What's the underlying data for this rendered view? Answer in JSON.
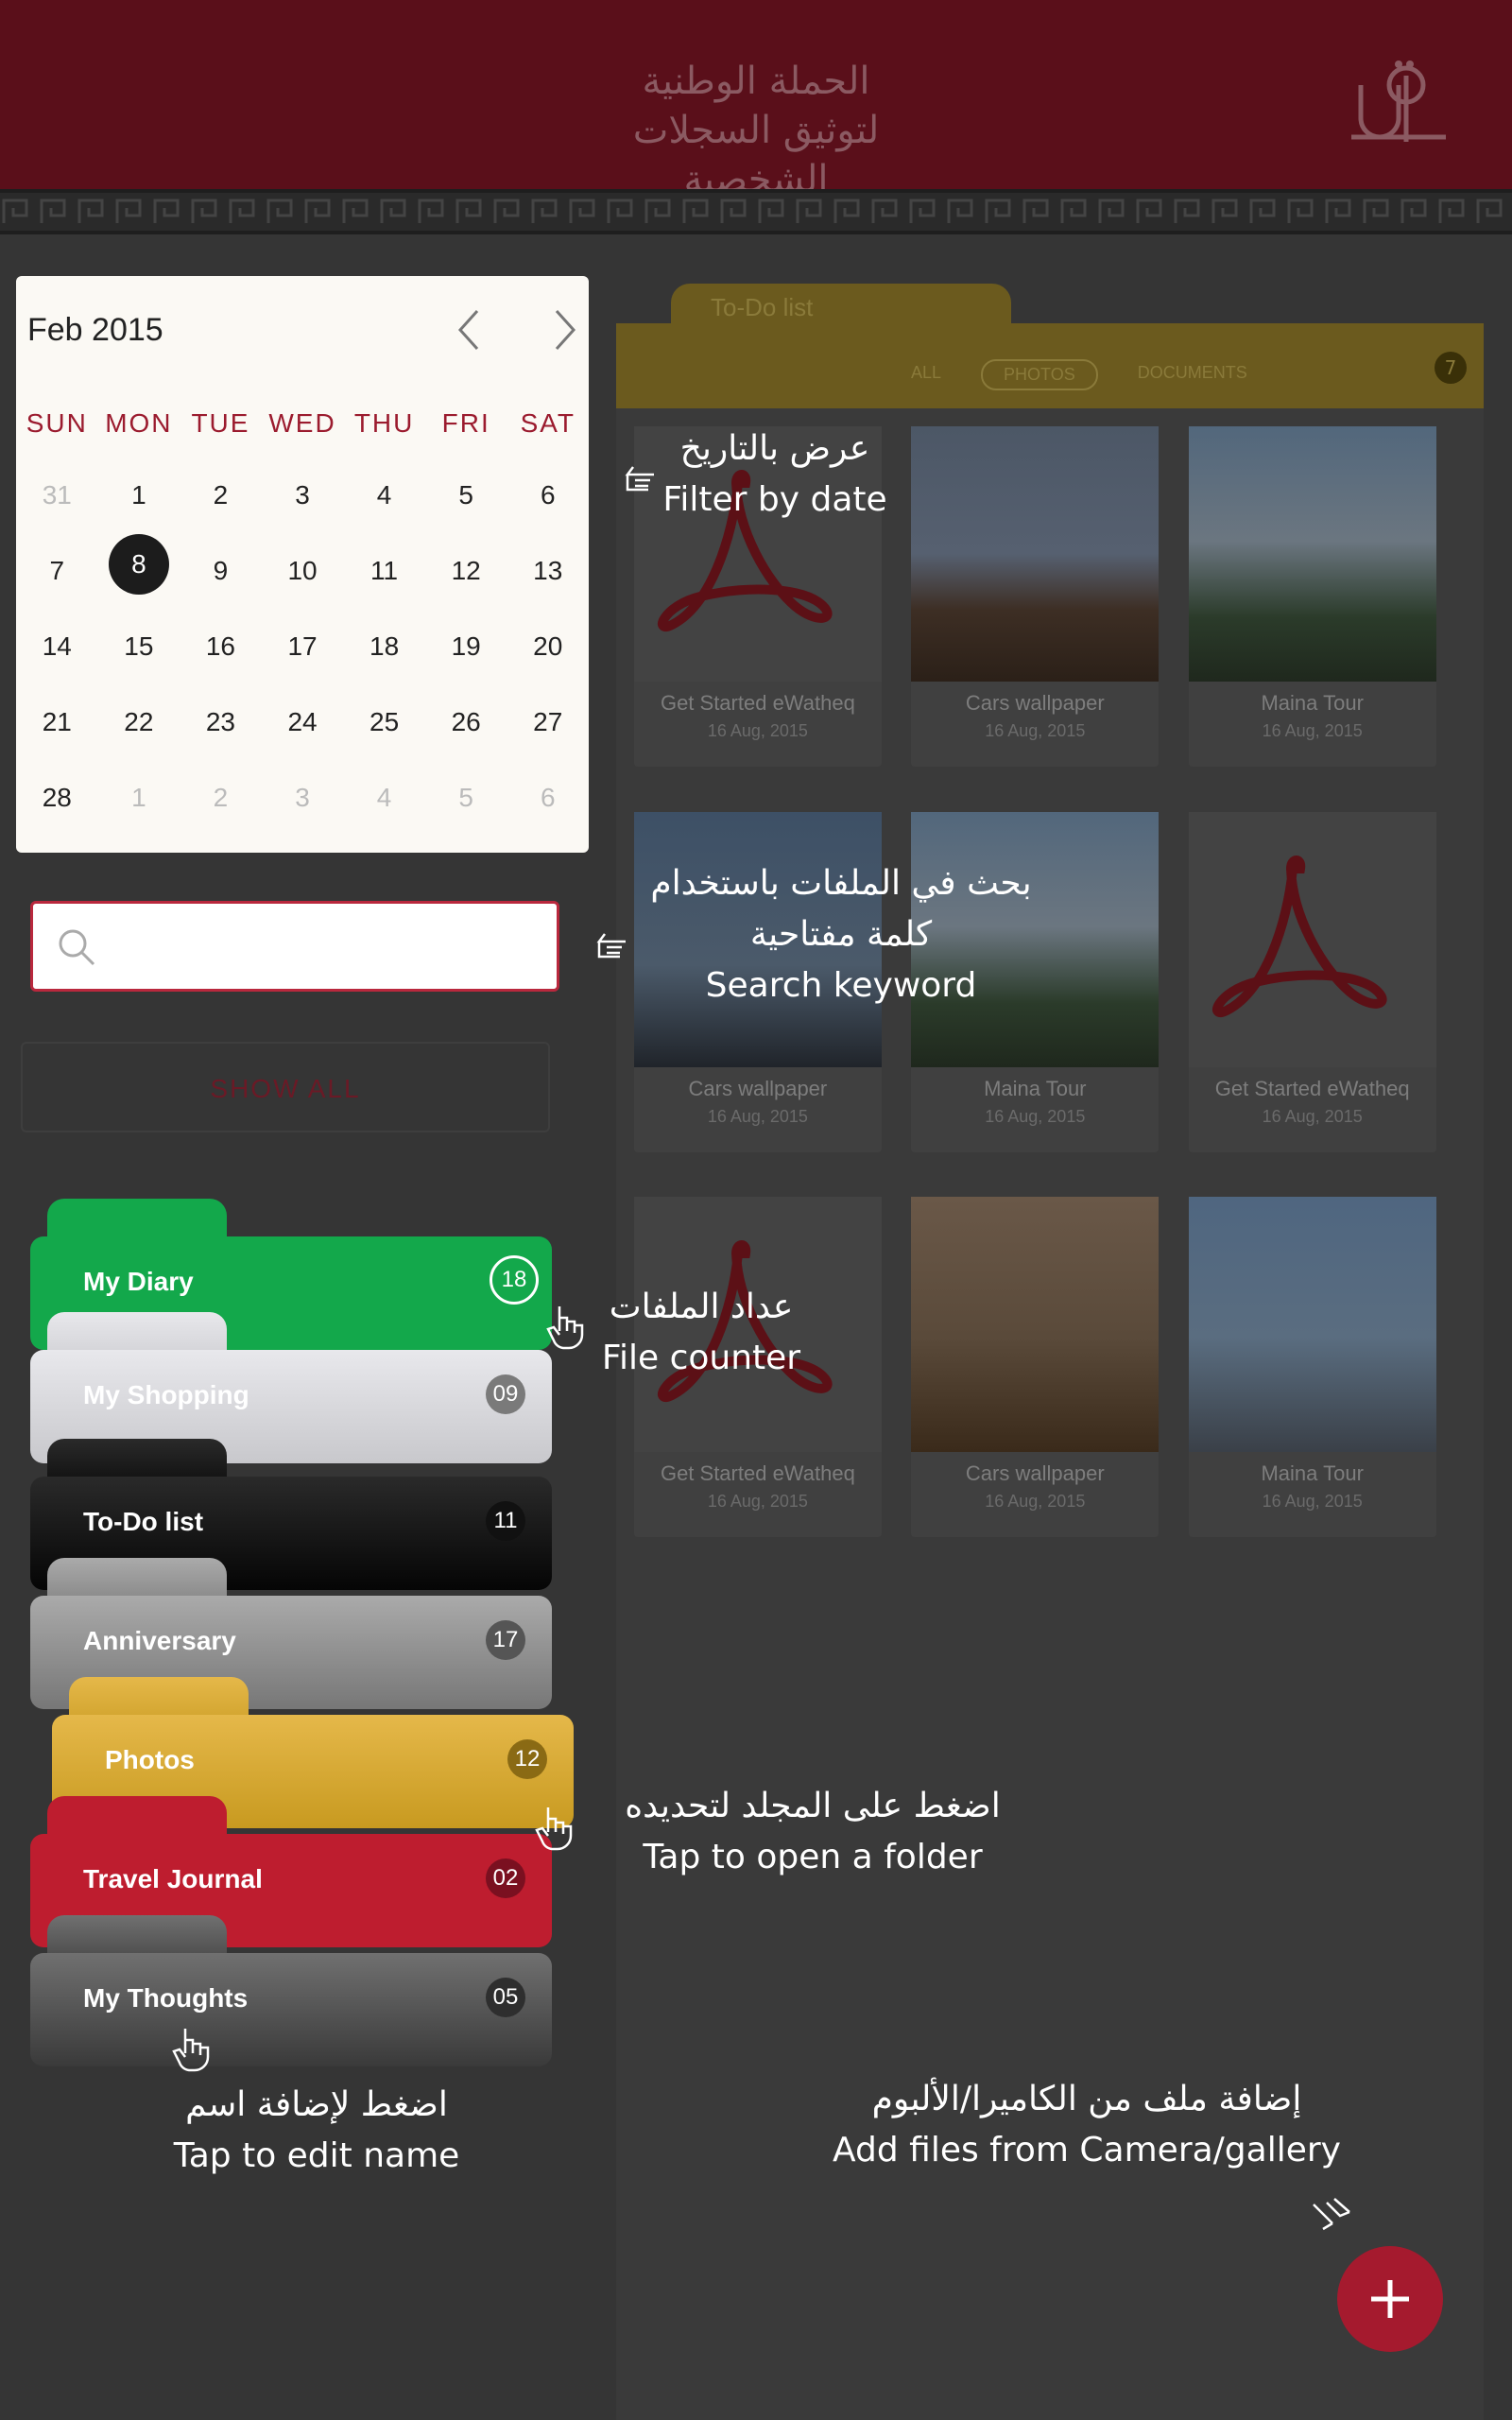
{
  "header": {
    "title_line1": "الحملة الوطنية",
    "title_line2": "لتوثيق السجلات الشخصية",
    "logo_icon": "app-logo-icon"
  },
  "calendar": {
    "month_label": "Feb 2015",
    "weekdays": [
      "SUN",
      "MON",
      "TUE",
      "WED",
      "THU",
      "FRI",
      "SAT"
    ],
    "weeks": [
      [
        {
          "d": "31",
          "m": true
        },
        {
          "d": "1"
        },
        {
          "d": "2"
        },
        {
          "d": "3"
        },
        {
          "d": "4"
        },
        {
          "d": "5"
        },
        {
          "d": "6"
        }
      ],
      [
        {
          "d": "7"
        },
        {
          "d": "8",
          "s": true
        },
        {
          "d": "9"
        },
        {
          "d": "10"
        },
        {
          "d": "11"
        },
        {
          "d": "12"
        },
        {
          "d": "13"
        }
      ],
      [
        {
          "d": "14"
        },
        {
          "d": "15"
        },
        {
          "d": "16"
        },
        {
          "d": "17"
        },
        {
          "d": "18"
        },
        {
          "d": "19"
        },
        {
          "d": "20"
        }
      ],
      [
        {
          "d": "21"
        },
        {
          "d": "22"
        },
        {
          "d": "23"
        },
        {
          "d": "24"
        },
        {
          "d": "25"
        },
        {
          "d": "26"
        },
        {
          "d": "27"
        }
      ],
      [
        {
          "d": "28"
        },
        {
          "d": "1",
          "m": true
        },
        {
          "d": "2",
          "m": true
        },
        {
          "d": "3",
          "m": true
        },
        {
          "d": "4",
          "m": true
        },
        {
          "d": "5",
          "m": true
        },
        {
          "d": "6",
          "m": true
        }
      ]
    ],
    "accent_color": "#9b1b2e"
  },
  "search": {
    "placeholder": ""
  },
  "show_all_label": "SHOW ALL",
  "folders": [
    {
      "label": "My Diary",
      "count": "18"
    },
    {
      "label": "My Shopping",
      "count": "09"
    },
    {
      "label": "To-Do list",
      "count": "11"
    },
    {
      "label": "Anniversary",
      "count": "17"
    },
    {
      "label": "Photos",
      "count": "12"
    },
    {
      "label": "Travel Journal",
      "count": "02"
    },
    {
      "label": "My Thoughts",
      "count": "05"
    }
  ],
  "panel": {
    "title": "To-Do list",
    "filters": [
      "ALL",
      "PHOTOS",
      "DOCUMENTS"
    ],
    "active_filter": "PHOTOS",
    "count": "7",
    "cards": [
      {
        "title": "Get Started eWatheq",
        "date": "16 Aug, 2015",
        "kind": "pdf"
      },
      {
        "title": "Cars wallpaper",
        "date": "16 Aug, 2015",
        "kind": "city"
      },
      {
        "title": "Maina Tour",
        "date": "16 Aug, 2015",
        "kind": "mosque"
      },
      {
        "title": "Cars wallpaper",
        "date": "16 Aug, 2015",
        "kind": "tower"
      },
      {
        "title": "Maina Tour",
        "date": "16 Aug, 2015",
        "kind": "mosque"
      },
      {
        "title": "Get Started eWatheq",
        "date": "16 Aug, 2015",
        "kind": "pdf"
      },
      {
        "title": "Get Started eWatheq",
        "date": "16 Aug, 2015",
        "kind": "pdf"
      },
      {
        "title": "Cars wallpaper",
        "date": "16 Aug, 2015",
        "kind": "palace"
      },
      {
        "title": "Maina Tour",
        "date": "16 Aug, 2015",
        "kind": "statue"
      }
    ]
  },
  "annotations": {
    "filter_date_ar": "عرض بالتاريخ",
    "filter_date_en": "Filter by date",
    "search_ar_1": "بحث في الملفات باستخدام",
    "search_ar_2": "كلمة مفتاحية",
    "search_en": "Search keyword",
    "counter_ar": "عداد الملفات",
    "counter_en": "File counter",
    "open_ar": "اضغط على المجلد لتحديده",
    "open_en": "Tap to open a folder",
    "edit_ar": "اضغط لإضافة اسم",
    "edit_en": "Tap to edit name",
    "add_ar": "إضافة ملف من الكاميرا/الألبوم",
    "add_en": "Add files from Camera/gallery"
  },
  "fab": {
    "icon": "plus-icon",
    "color": "#a51a2e"
  }
}
